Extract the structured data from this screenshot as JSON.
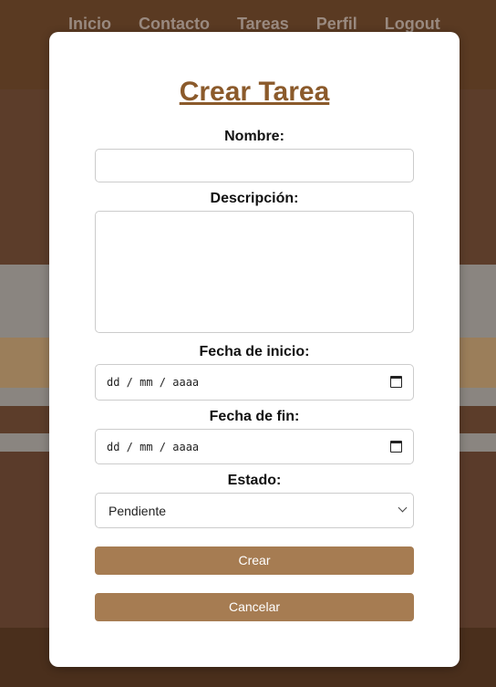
{
  "nav": {
    "items": [
      "Inicio",
      "Contacto",
      "Tareas",
      "Perfil",
      "Logout"
    ]
  },
  "modal": {
    "title": "Crear Tarea",
    "fields": {
      "nombre_label": "Nombre:",
      "nombre_value": "",
      "descripcion_label": "Descripción:",
      "descripcion_value": "",
      "fecha_inicio_label": "Fecha de inicio:",
      "fecha_inicio_placeholder": "dd / mm / aaaa",
      "fecha_fin_label": "Fecha de fin:",
      "fecha_fin_placeholder": "dd / mm / aaaa",
      "estado_label": "Estado:",
      "estado_value": "Pendiente"
    },
    "buttons": {
      "crear": "Crear",
      "cancelar": "Cancelar"
    }
  },
  "colors": {
    "accent": "#a67c52",
    "title": "#8b5a2b",
    "background": "#4a3020"
  },
  "icons": {
    "calendar": "calendar-icon",
    "dropdown": "chevron-down-icon"
  }
}
